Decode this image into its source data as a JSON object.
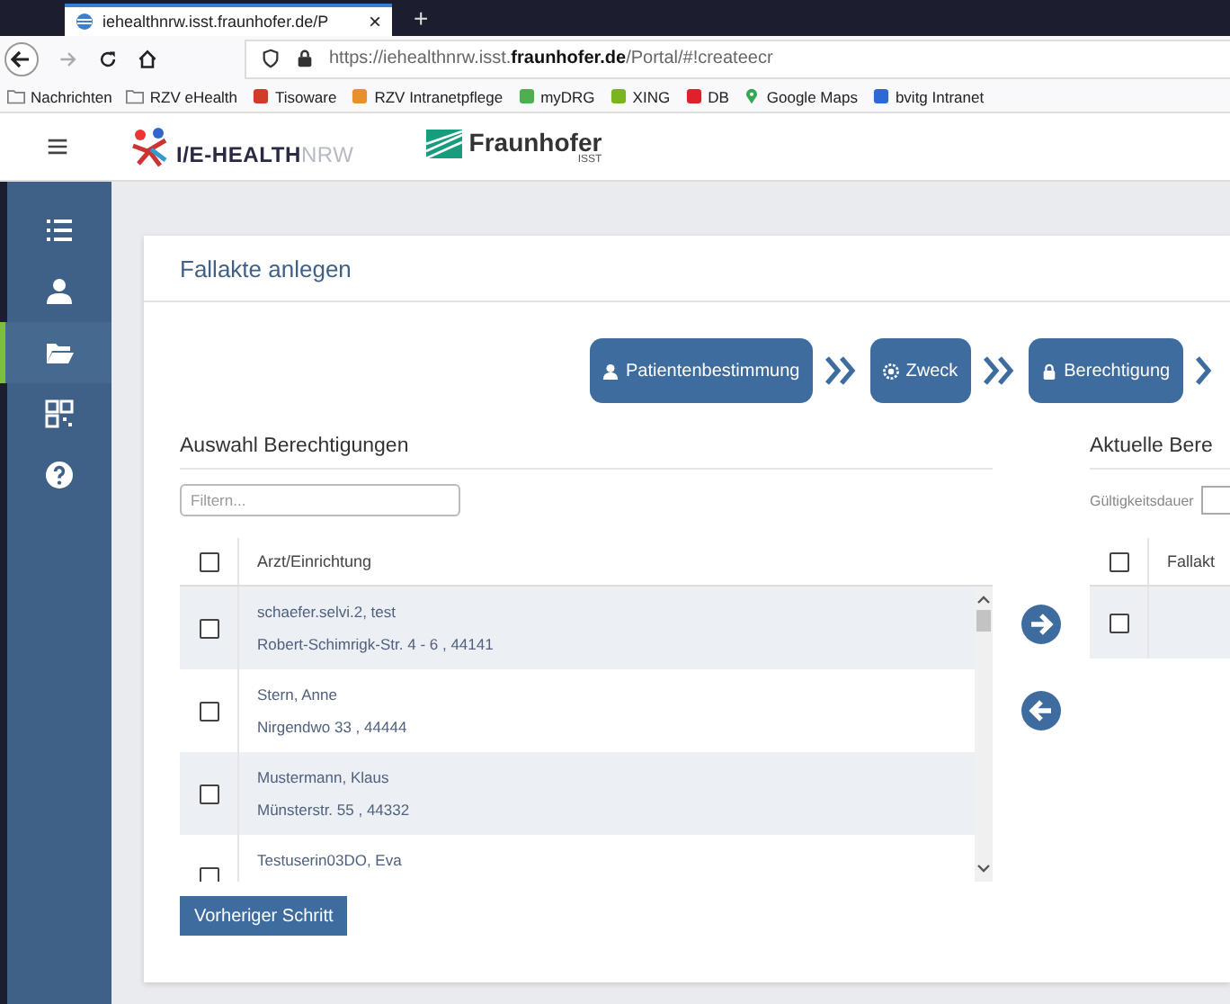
{
  "browser": {
    "tab": {
      "title": "iehealthnrw.isst.fraunhofer.de/P",
      "close": "×"
    },
    "new_tab": "+",
    "url": "https://iehealthnrw.isst.**fraunhofer.de**/Portal/#!createecr",
    "bookmarks": [
      {
        "label": "Nachrichten",
        "kind": "folder",
        "color": "#7a7a7a"
      },
      {
        "label": "RZV eHealth",
        "kind": "folder",
        "color": "#7a7a7a"
      },
      {
        "label": "Tisoware",
        "kind": "site",
        "color": "#d23a2a"
      },
      {
        "label": "RZV Intranetpflege",
        "kind": "site",
        "color": "#e8902a"
      },
      {
        "label": "myDRG",
        "kind": "site",
        "color": "#4caf50"
      },
      {
        "label": "XING",
        "kind": "site",
        "color": "#7ab51d"
      },
      {
        "label": "DB",
        "kind": "site",
        "color": "#e0202a"
      },
      {
        "label": "Google Maps",
        "kind": "pin",
        "color": "#34a853"
      },
      {
        "label": "bvitg Intranet",
        "kind": "site",
        "color": "#2a6ad2"
      }
    ]
  },
  "app": {
    "logo_bold": "I/E-HEALTH",
    "logo_light": "NRW",
    "partner": "Fraunhofer",
    "partner_sub": "ISST",
    "sidebar": [
      {
        "selected": false
      },
      {
        "selected": false
      },
      {
        "selected": true
      },
      {
        "selected": false
      },
      {
        "selected": false
      }
    ]
  },
  "card": {
    "title": "Fallakte anlegen",
    "steps": [
      {
        "label": "Patientenbestimmung"
      },
      {
        "label": "Zweck"
      },
      {
        "label": "Berechtigung"
      }
    ],
    "left": {
      "heading": "Auswahl Berechtigungen",
      "filter_placeholder": "Filtern...",
      "column": "Arzt/Einrichtung",
      "all_checked": false,
      "rows": [
        {
          "name": "schaefer.selvi.2, test",
          "address": "Robert-Schimrigk-Str. 4 - 6 , 44141",
          "checked": false
        },
        {
          "name": "Stern, Anne",
          "address": "Nirgendwo 33 , 44444",
          "checked": false
        },
        {
          "name": "Mustermann, Klaus",
          "address": "Münsterstr. 55 , 44332",
          "checked": false
        },
        {
          "name": "Testuserin03DO, Eva",
          "checked": false
        }
      ],
      "back_button": "Vorheriger Schritt"
    },
    "right": {
      "heading": "Aktuelle Bere",
      "validity_label": "Gültigkeitsdauer",
      "column": "Fallakt",
      "all_checked": false,
      "rows": [
        {
          "checked": false
        }
      ]
    }
  }
}
